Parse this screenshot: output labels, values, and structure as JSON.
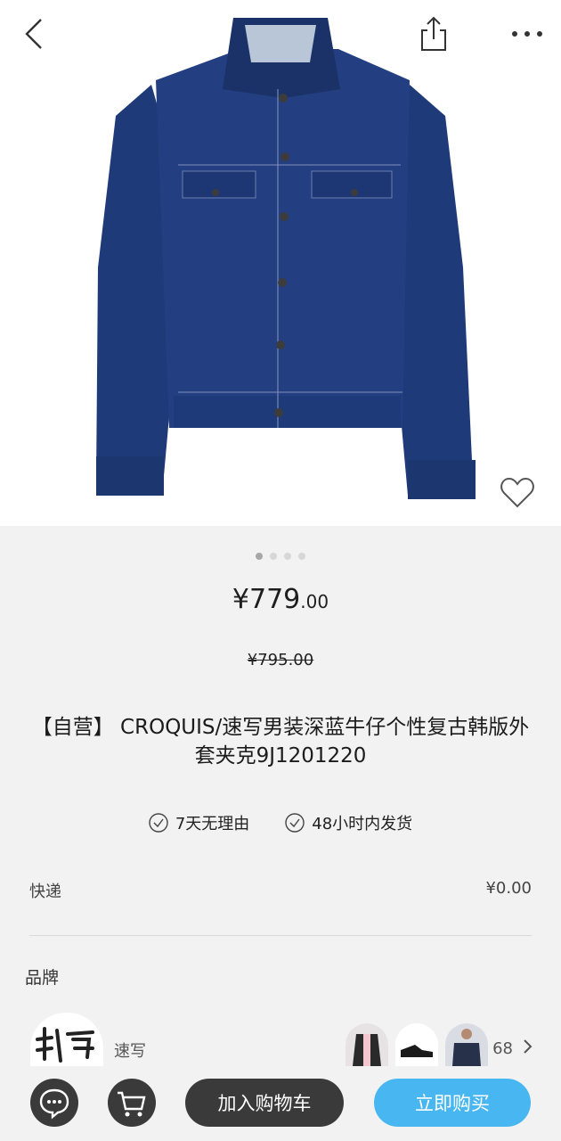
{
  "header": {
    "back_icon": "chevron-left-icon",
    "share_icon": "share-icon",
    "more_icon": "more-dots-icon"
  },
  "gallery": {
    "image_count": 4,
    "active_index": 0,
    "favorite_icon": "heart-outline-icon"
  },
  "price": {
    "current_main": "¥779",
    "current_decimal": ".00",
    "original": "¥795.00"
  },
  "product": {
    "title": "【自营】 CROQUIS/速写男装深蓝牛仔个性复古韩版外套夹克9J1201220"
  },
  "features": [
    {
      "label": "7天无理由",
      "icon": "check-circle-icon"
    },
    {
      "label": "48小时内发货",
      "icon": "check-circle-icon"
    }
  ],
  "shipping": {
    "label": "快递",
    "value": "¥0.00"
  },
  "brand": {
    "section_label": "品牌",
    "name": "速写",
    "product_count": "68"
  },
  "bottom_bar": {
    "chat_icon": "chat-bubble-icon",
    "cart_icon": "cart-icon",
    "add_to_cart": "加入购物车",
    "buy_now": "立即购买"
  },
  "colors": {
    "accent": "#48b6f0",
    "dark": "#3a3a3a",
    "background": "#f2f2f2"
  }
}
